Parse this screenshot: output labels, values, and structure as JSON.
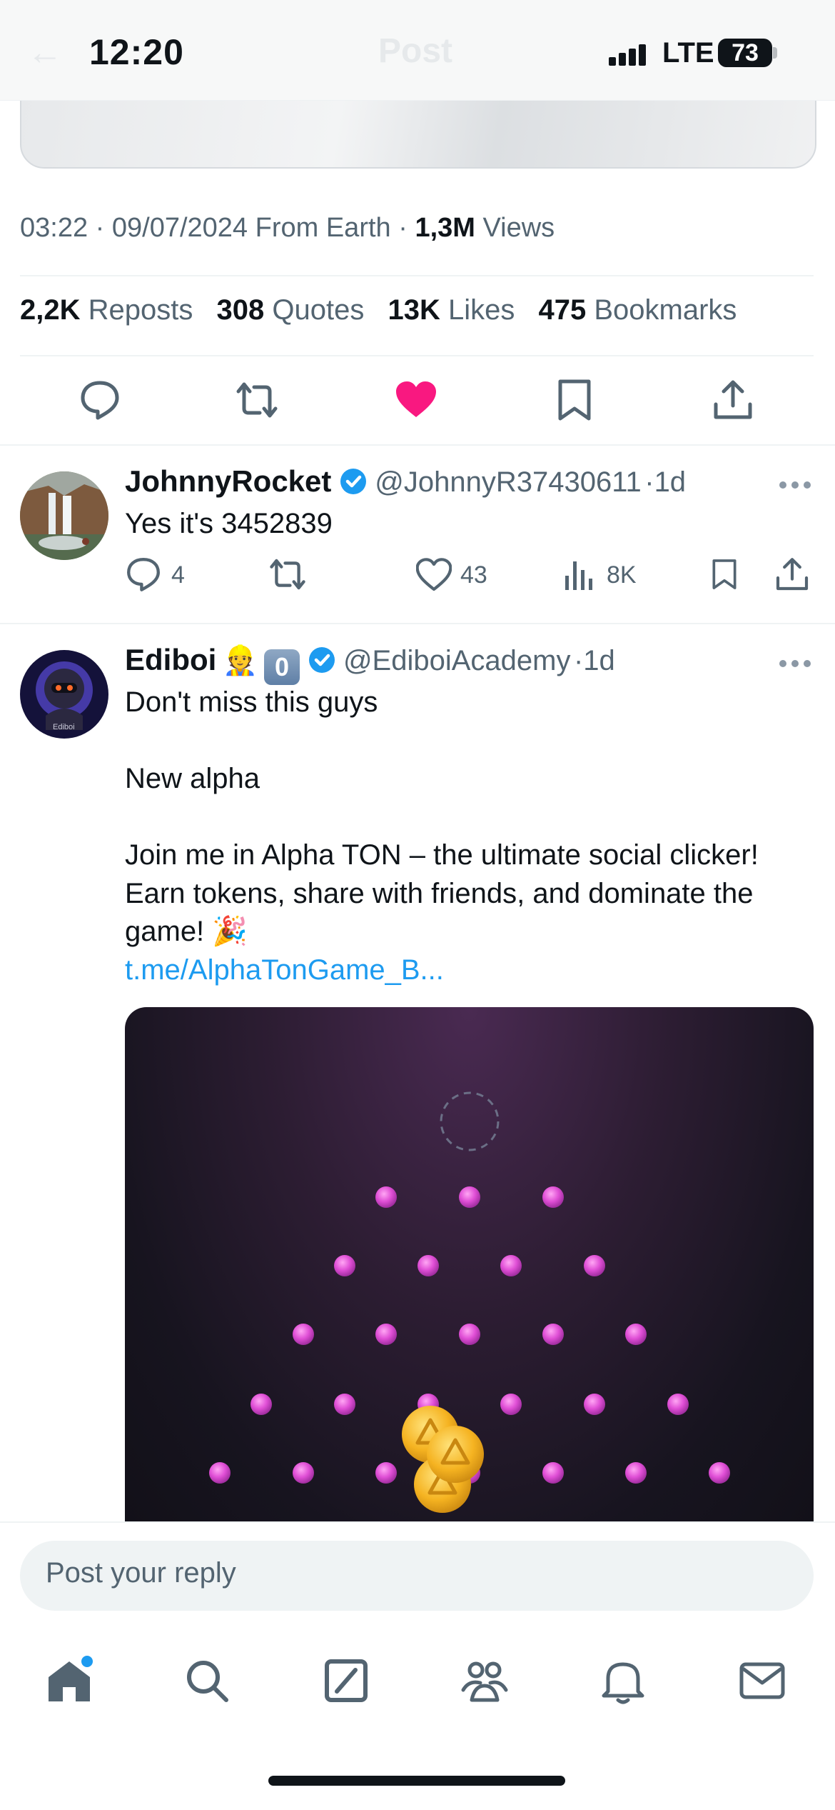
{
  "status_bar": {
    "time": "12:20",
    "network": "LTE",
    "battery": "73",
    "header_title": "Post",
    "back_arrow": "←"
  },
  "post_meta": {
    "time": "03:22",
    "date": "09/07/2024",
    "source": "From Earth",
    "views_count": "1,3M",
    "views_label": "Views"
  },
  "stats": {
    "reposts_count": "2,2K",
    "reposts_label": "Reposts",
    "quotes_count": "308",
    "quotes_label": "Quotes",
    "likes_count": "13K",
    "likes_label": "Likes",
    "bookmarks_count": "475",
    "bookmarks_label": "Bookmarks"
  },
  "replies": [
    {
      "name": "JohnnyRocket",
      "handle": "@JohnnyR37430611",
      "time": "1d",
      "text": "Yes it's 3452839",
      "replies": "4",
      "likes": "43",
      "views": "8K"
    },
    {
      "name": "Ediboi",
      "emoji": "👷",
      "badge": "0",
      "handle": "@EdiboiAcademy",
      "time": "1d",
      "lines": [
        "Don't miss this guys",
        "New alpha",
        "Join me in Alpha TON – the ultimate social clicker!",
        "Earn tokens, share with friends, and dominate the",
        "game! 🎉"
      ],
      "link": "t.me/AlphaTonGame_B...",
      "avatar_caption": "Ediboi"
    }
  ],
  "composer": {
    "placeholder": "Post your reply"
  },
  "colors": {
    "accent": "#1d9bf0",
    "like": "#f91880",
    "peg": "#e04fd6",
    "coin": "#f5b321"
  },
  "icons": {
    "action_bar": [
      "reply-icon",
      "repost-icon",
      "like-icon-filled",
      "bookmark-icon",
      "share-icon"
    ],
    "tabs": [
      "home-icon",
      "search-icon",
      "grok-icon",
      "communities-icon",
      "notifications-icon",
      "messages-icon"
    ]
  }
}
